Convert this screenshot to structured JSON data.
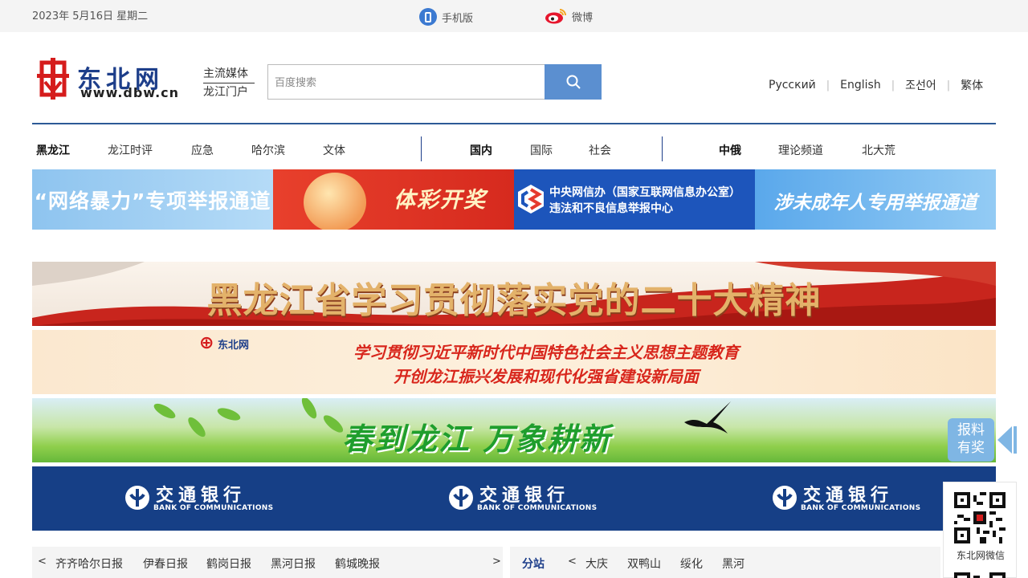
{
  "topbar": {
    "date": "2023年 5月16日  星期二",
    "mobile_label": "手机版",
    "weibo_label": "微博"
  },
  "logo": {
    "name": "东北网",
    "url": "www.dbw.cn"
  },
  "slogan": {
    "line1": "主流媒体",
    "line2": "龙江门户"
  },
  "search": {
    "placeholder": "百度搜索"
  },
  "languages": [
    "Русский",
    "English",
    "조선어",
    "繁体"
  ],
  "nav": {
    "group1": [
      "黑龙江",
      "龙江时评",
      "应急",
      "哈尔滨",
      "文体"
    ],
    "group2": [
      "国内",
      "国际",
      "社会"
    ],
    "group3": [
      "中俄",
      "理论频道",
      "北大荒"
    ]
  },
  "banners": {
    "b1": "“网络暴力”专项举报通道",
    "b2": "体彩开奖",
    "b3_line1": "中央网信办（国家互联网信息办公室）",
    "b3_line2": "违法和不良信息举报中心",
    "b4": "涉未成年人专用举报通道"
  },
  "wide": {
    "w1": "黑龙江省学习贯彻落实党的二十大精神",
    "w2_logo": "东北网",
    "w2_line1": "学习贯彻习近平新时代中国特色社会主义思想主题教育",
    "w2_line2": "开创龙江振兴发展和现代化强省建设新局面",
    "w3": "春到龙江  万象耕新",
    "bocom_cn": "交通银行",
    "bocom_en": "BANK OF COMMUNICATIONS"
  },
  "report": {
    "line1": "报料",
    "line2": "有奖"
  },
  "qr_caption": "东北网微信",
  "papers": {
    "prev": "<",
    "next": ">",
    "items": [
      "齐齐哈尔日报",
      "伊春日报",
      "鹤岗日报",
      "黑河日报",
      "鹤城晚报"
    ]
  },
  "stations": {
    "title": "分站",
    "prev": "<",
    "items": [
      "大庆",
      "双鸭山",
      "绥化",
      "黑河"
    ]
  },
  "colors": {
    "brand_blue": "#1d3e8a",
    "search_button": "#5b8fd0",
    "bocom_blue": "#163f86"
  }
}
